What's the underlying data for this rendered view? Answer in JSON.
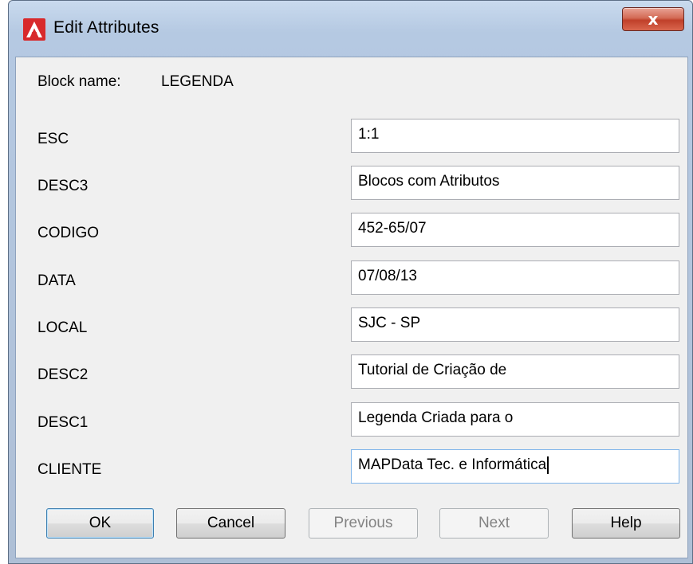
{
  "window": {
    "title": "Edit Attributes",
    "close_glyph": "x"
  },
  "block": {
    "label": "Block name:",
    "value": "LEGENDA"
  },
  "attributes": [
    {
      "tag": "ESC",
      "value": "1:1"
    },
    {
      "tag": "DESC3",
      "value": "Blocos com Atributos"
    },
    {
      "tag": "CODIGO",
      "value": "452-65/07"
    },
    {
      "tag": "DATA",
      "value": "07/08/13"
    },
    {
      "tag": "LOCAL",
      "value": "SJC - SP"
    },
    {
      "tag": "DESC2",
      "value": "Tutorial de Criação de"
    },
    {
      "tag": "DESC1",
      "value": "Legenda Criada para o"
    },
    {
      "tag": "CLIENTE",
      "value": "MAPData Tec. e Informática"
    }
  ],
  "buttons": {
    "ok": "OK",
    "cancel": "Cancel",
    "previous": "Previous",
    "next": "Next",
    "help": "Help"
  },
  "colors": {
    "app_icon_red": "#d8292b",
    "close_button_red": "#c0402a",
    "dialog_bg": "#f0f0f0"
  }
}
